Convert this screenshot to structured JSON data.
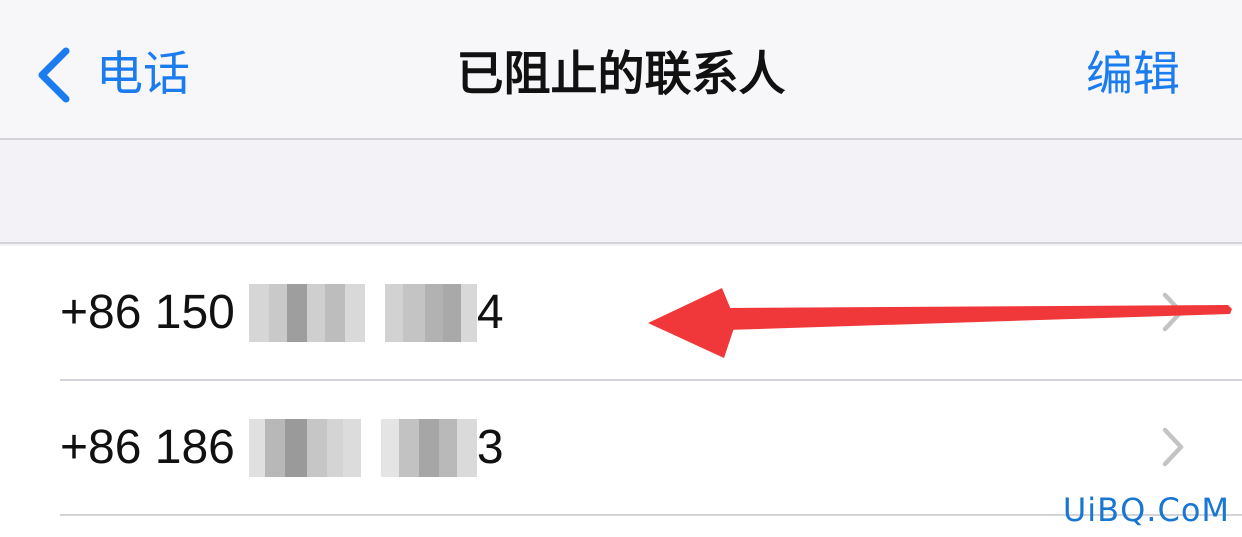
{
  "navbar": {
    "back_label": "电话",
    "title": "已阻止的联系人",
    "edit_label": "编辑"
  },
  "contacts": [
    {
      "prefix": "+86 150",
      "last_digit": "4",
      "redacted": true
    },
    {
      "prefix": "+86 186",
      "last_digit": "3",
      "redacted": true
    }
  ],
  "icons": {
    "back": "chevron-left-icon",
    "row_disclosure": "chevron-right-icon",
    "annotation": "red-arrow-icon"
  },
  "colors": {
    "accent": "#1b7cf0",
    "annotation_arrow": "#f0383b",
    "separator": "#d4d4d8",
    "grouped_background": "#f2f2f7"
  },
  "watermark": "UiBQ.CoM"
}
